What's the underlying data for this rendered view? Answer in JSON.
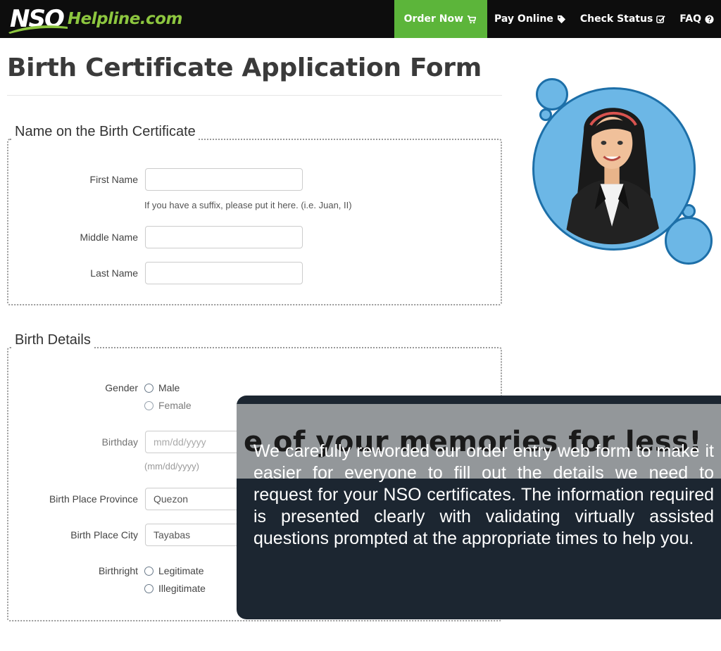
{
  "brand": {
    "logo_nso": "NSO",
    "logo_rest": "Helpline.com"
  },
  "nav": {
    "order_now": "Order Now",
    "pay_online": "Pay Online",
    "check_status": "Check Status",
    "faq": "FAQ"
  },
  "page": {
    "title": "Birth Certificate Application Form"
  },
  "section_name": {
    "legend": "Name on the Birth Certificate",
    "first_name_label": "First Name",
    "first_name_value": "",
    "suffix_help": "If you have a suffix, please put it here. (i.e. Juan, II)",
    "middle_name_label": "Middle Name",
    "middle_name_value": "",
    "last_name_label": "Last Name",
    "last_name_value": ""
  },
  "section_birth": {
    "legend": "Birth Details",
    "gender_label": "Gender",
    "gender_options": [
      "Male",
      "Female"
    ],
    "birthday_label": "Birthday",
    "birthday_placeholder": "mm/dd/yyyy",
    "birthday_help": "(mm/dd/yyyy)",
    "province_label": "Birth Place Province",
    "province_value": "Quezon",
    "city_label": "Birth Place City",
    "city_value": "Tayabas",
    "birthright_label": "Birthright",
    "birthright_options": [
      "Legitimate",
      "Illegitimate"
    ]
  },
  "overlay": {
    "ghost_text": "e of your memories for less!",
    "message": "We carefully reworded our order entry web form to make it easier for everyone to fill out the details we need to request for your NSO certificates. The information required is presented clearly with validating virtually assisted questions prompted at the appropriate times to help you."
  },
  "colors": {
    "nav_bg": "#0d0d0d",
    "order_green": "#5cb53a",
    "brand_green": "#8dc63f",
    "bubble_blue": "#6cb7e6",
    "bubble_border": "#1d6fa8",
    "overlay_bg": "#1c2631"
  },
  "icons": {
    "order_now": "cart-icon",
    "pay_online": "tag-icon",
    "check_status": "check-square-icon",
    "faq": "question-circle-icon",
    "avatar": "support-agent-avatar"
  }
}
